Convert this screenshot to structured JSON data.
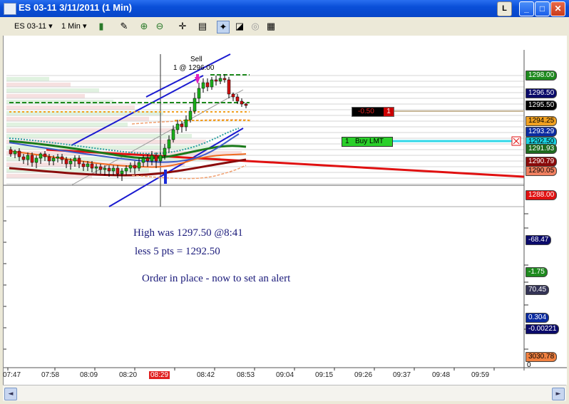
{
  "window": {
    "title": "ES 03-11   3/11/2011  (1 Min)",
    "l_label": "L",
    "min_glyph": "_",
    "max_glyph": "□",
    "close_glyph": "✕"
  },
  "toolbar": {
    "instrument": "ES 03-11",
    "interval": "1 Min",
    "dropdown_glyph": "▾"
  },
  "price_axis": [
    {
      "label": "1298.00",
      "color": "#1e8a1e"
    },
    {
      "label": "1296.50",
      "color": "#0a0a6a"
    },
    {
      "label": "1295.50",
      "color": "#000000"
    },
    {
      "label": "1294.25",
      "color": "#f0a020"
    },
    {
      "label": "1293.29",
      "color": "#0a2aa0"
    },
    {
      "label": "1292.50",
      "color": "#1ad0e0"
    },
    {
      "label": "1291.93",
      "color": "#1e6a1e"
    },
    {
      "label": "1290.79",
      "color": "#8a0a0a"
    },
    {
      "label": "1290.05",
      "color": "#f08060"
    },
    {
      "label": "1288.00",
      "color": "#e01010"
    }
  ],
  "position_box": {
    "pnl": "-0.50",
    "qty": "1"
  },
  "buy_order": {
    "qty": "1",
    "label": "Buy LMT"
  },
  "sell_marker": {
    "line1": "Sell",
    "line2": "1 @ 1296.00"
  },
  "notes": {
    "line1": "High was 1297.50 @8:41",
    "line2": "less 5 pts = 1292.50",
    "line3": "Order in place - now to set an alert"
  },
  "indicator_values": [
    {
      "label": "-68.47",
      "color": "#0a0a6a"
    },
    {
      "label": "-1.75",
      "color": "#1e8a1e"
    },
    {
      "label": "70.45",
      "color": "#333355"
    },
    {
      "label": "0.304",
      "color": "#0a2aa0"
    },
    {
      "label": "-0.00221",
      "color": "#0a0a6a"
    },
    {
      "label": "3030.78",
      "color": "#f08040"
    }
  ],
  "indicator_zero": "0",
  "time_labels": [
    "07:47",
    "07:58",
    "08:09",
    "08:20",
    "08:29",
    "08:42",
    "08:53",
    "09:04",
    "09:15",
    "09:26",
    "09:37",
    "09:48",
    "09:59"
  ],
  "time_cursor": {
    "label": "08:29",
    "color": "#e02020"
  },
  "scroll": {
    "left_glyph": "◄",
    "right_glyph": "►"
  }
}
